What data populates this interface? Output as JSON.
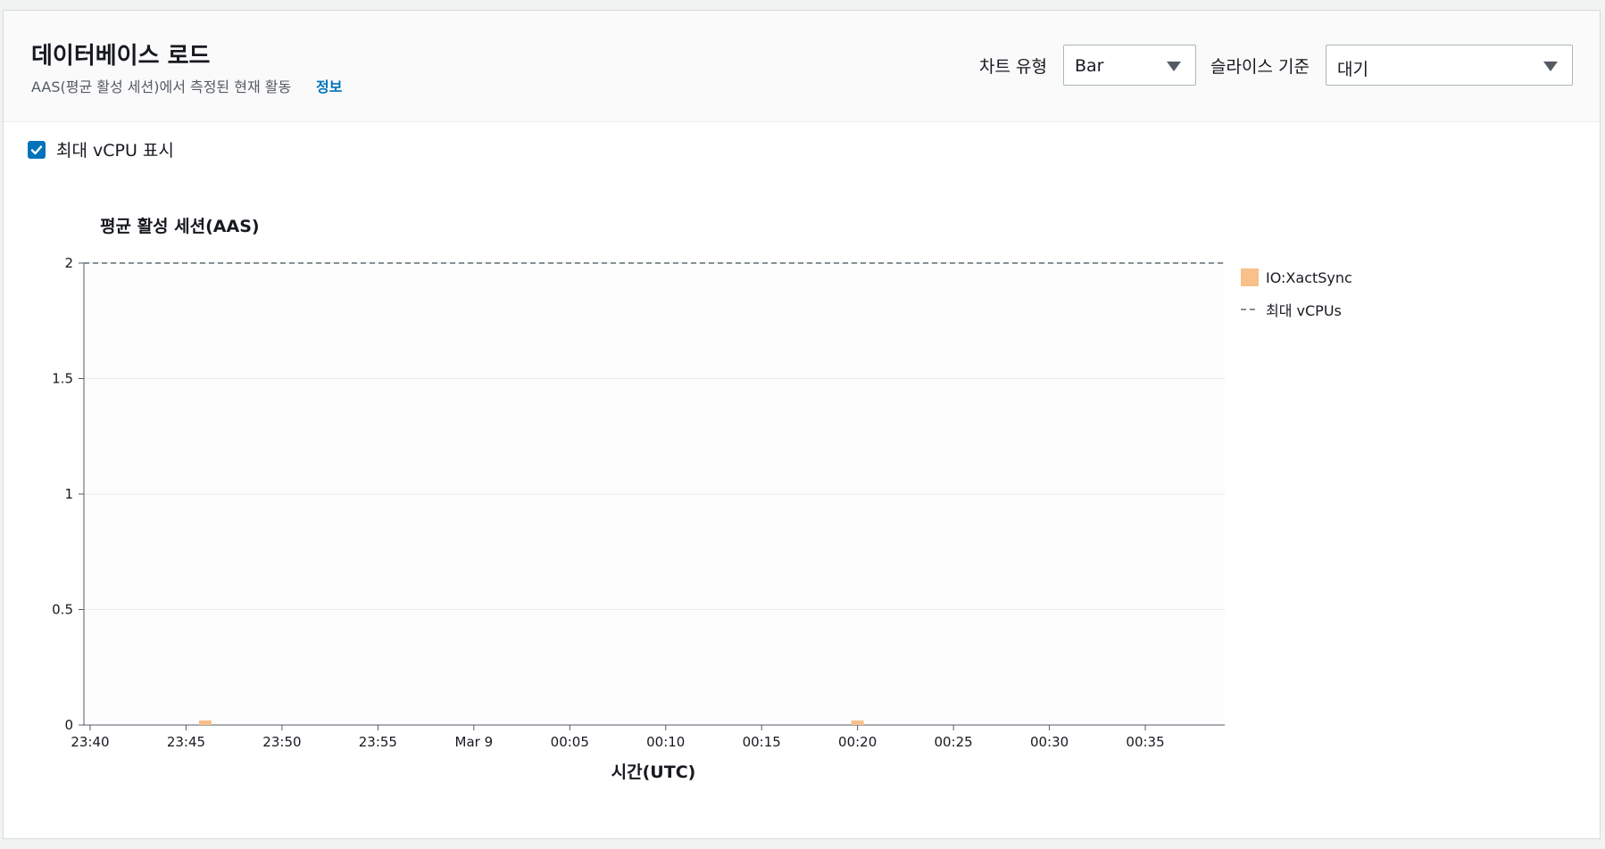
{
  "header": {
    "title": "데이터베이스 로드",
    "subtitle": "AAS(평균 활성 세션)에서 측정된 현재 활동",
    "info_link": "정보"
  },
  "controls": {
    "chart_type_label": "차트 유형",
    "chart_type_value": "Bar",
    "slice_label": "슬라이스 기준",
    "slice_value": "대기"
  },
  "options": {
    "show_max_vcpu_label": "최대 vCPU 표시",
    "show_max_vcpu_checked": true
  },
  "colors": {
    "accent": "#0073bb",
    "series_io": "#f8c08a",
    "max_line": "#879196"
  },
  "chart_data": {
    "type": "bar",
    "title": "평균 활성 세션(AAS)",
    "xlabel": "시간(UTC)",
    "ylabel": "",
    "ylim": [
      0,
      2
    ],
    "yticks": [
      0,
      0.5,
      1,
      1.5,
      2
    ],
    "ytick_labels": [
      "0",
      "0.5",
      "1",
      "1.5",
      "2"
    ],
    "xticks": [
      "23:40",
      "23:45",
      "23:50",
      "23:55",
      "Mar 9",
      "00:05",
      "00:10",
      "00:15",
      "00:20",
      "00:25",
      "00:30",
      "00:35"
    ],
    "xrange_minutes": [
      0,
      59
    ],
    "series": [
      {
        "name": "IO:XactSync",
        "color": "#f8c08a",
        "points": [
          {
            "t": 6,
            "value": 0.02
          },
          {
            "t": 40,
            "value": 0.02
          }
        ]
      }
    ],
    "reference_lines": [
      {
        "name": "최대 vCPUs",
        "value": 2,
        "style": "dashed"
      }
    ],
    "legend": "right",
    "grid": true
  }
}
